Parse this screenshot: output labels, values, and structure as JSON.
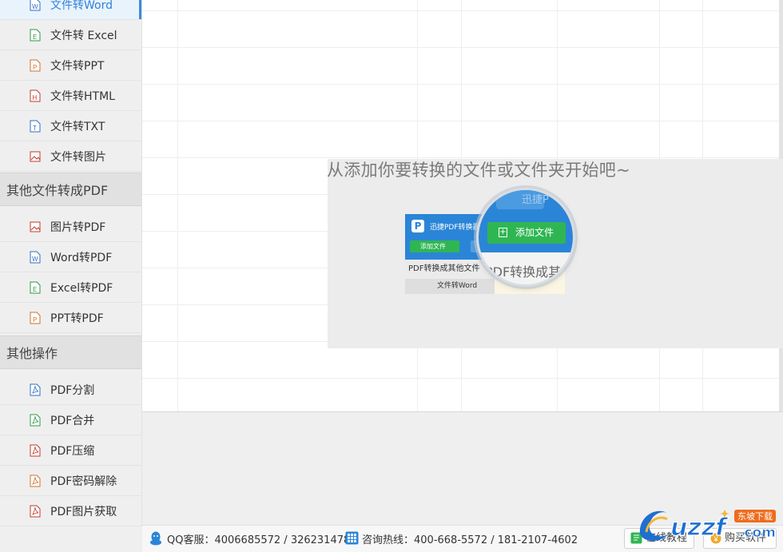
{
  "sidebar": {
    "items_top": [
      {
        "label": "文件转Word",
        "icon": "word-file-icon",
        "color": "#2f6fc6",
        "letter": "W"
      },
      {
        "label": "文件转 Excel",
        "icon": "excel-file-icon",
        "color": "#2e9a47",
        "letter": "E"
      },
      {
        "label": "文件转PPT",
        "icon": "ppt-file-icon",
        "color": "#d0702a",
        "letter": "P"
      },
      {
        "label": "文件转HTML",
        "icon": "html-file-icon",
        "color": "#c23b2b",
        "letter": "H"
      },
      {
        "label": "文件转TXT",
        "icon": "txt-file-icon",
        "color": "#2f6fc6",
        "letter": "T"
      },
      {
        "label": "文件转图片",
        "icon": "image-file-icon",
        "color": "#c23b2b",
        "letter": ""
      }
    ],
    "group2": "其他文件转成PDF",
    "items_mid": [
      {
        "label": "图片转PDF",
        "icon": "image-file-icon",
        "color": "#c23b2b",
        "letter": ""
      },
      {
        "label": "Word转PDF",
        "icon": "word-file-icon",
        "color": "#2f6fc6",
        "letter": "W"
      },
      {
        "label": "Excel转PDF",
        "icon": "excel-file-icon",
        "color": "#2e9a47",
        "letter": "E"
      },
      {
        "label": "PPT转PDF",
        "icon": "ppt-file-icon",
        "color": "#d0702a",
        "letter": "P"
      }
    ],
    "group3": "其他操作",
    "items_bottom": [
      {
        "label": "PDF分割",
        "icon": "pdf-file-icon",
        "color": "#2f6fc6"
      },
      {
        "label": "PDF合并",
        "icon": "pdf-file-icon",
        "color": "#2e9a47"
      },
      {
        "label": "PDF压缩",
        "icon": "pdf-file-icon",
        "color": "#c23b2b"
      },
      {
        "label": "PDF密码解除",
        "icon": "pdf-file-icon",
        "color": "#d0702a"
      },
      {
        "label": "PDF图片获取",
        "icon": "pdf-file-icon",
        "color": "#c23b2b"
      }
    ]
  },
  "overlay": {
    "tip": "从添加你要转换的文件或文件夹开始吧~",
    "mini_title": "迅捷PDF转换器",
    "mini_add": "添加文件",
    "mini_row1": "PDF转换成其他文件",
    "mini_row2": "文件转Word",
    "mag_tab": "迅捷P",
    "mag_add": "添加文件",
    "mag_cut": "PDF转换成其"
  },
  "status": {
    "qq": "QQ客服：4006685572 / 326231478",
    "hotline": "咨询热线：400-668-5572 / 181-2107-4602",
    "online_tutorial": "在线教程",
    "buy": "购买软件"
  },
  "watermark": {
    "text": "uzzf",
    "tld": ".com",
    "badge": "东坡下载"
  },
  "colors": {
    "accent": "#2b85d7",
    "green": "#2fb653",
    "sidebar_bg": "#efefef",
    "group_bg": "#e1e1e1"
  }
}
